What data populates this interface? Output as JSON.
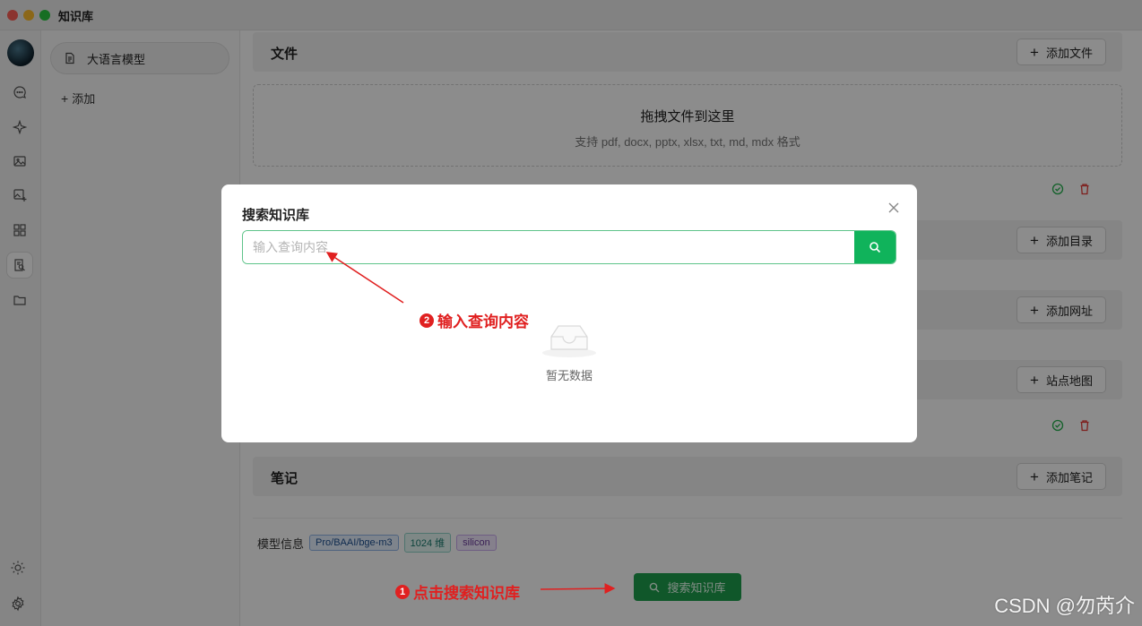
{
  "app": {
    "title": "知识库"
  },
  "iconbar": {
    "items": [
      "chat-icon",
      "sparkle-icon",
      "image-icon",
      "image-plus-icon",
      "apps-grid-icon",
      "knowledge-icon",
      "folder-icon"
    ],
    "bottom": [
      "sun-icon",
      "gear-icon"
    ]
  },
  "sidebar": {
    "knowledge_bases": [
      {
        "label": "大语言模型",
        "icon": "document-icon"
      }
    ],
    "add_label": "添加"
  },
  "main": {
    "files": {
      "title": "文件",
      "add_button": "添加文件",
      "dropzone_title": "拖拽文件到这里",
      "dropzone_sub": "支持 pdf, docx, pptx, xlsx, txt, md, mdx 格式"
    },
    "directory_button": "添加目录",
    "url_button": "添加网址",
    "sitemap_button": "站点地图",
    "notes": {
      "title": "笔记",
      "add_button": "添加笔记"
    },
    "model_info": {
      "label": "模型信息",
      "tags": [
        "Pro/BAAI/bge-m3",
        "1024 维",
        "silicon"
      ]
    },
    "search_button": "搜索知识库"
  },
  "modal": {
    "title": "搜索知识库",
    "input_placeholder": "输入查询内容",
    "empty_text": "暂无数据"
  },
  "annotations": {
    "step1": {
      "num": "1",
      "text": "点击搜索知识库"
    },
    "step2": {
      "num": "2",
      "text": "输入查询内容"
    },
    "color": "#e02020"
  },
  "watermark": "CSDN @勿芮介",
  "colors": {
    "accent": "#10b35b",
    "button_green": "#1e9e4e",
    "success": "#22b14c",
    "danger": "#e53935"
  }
}
